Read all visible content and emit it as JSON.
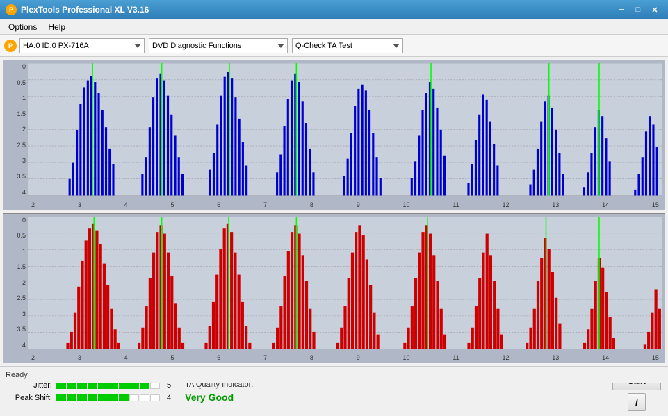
{
  "app": {
    "title": "PlexTools Professional XL V3.16",
    "icon": "P"
  },
  "window_controls": {
    "minimize": "─",
    "maximize": "□",
    "close": "✕"
  },
  "menu": {
    "items": [
      "Options",
      "Help"
    ]
  },
  "toolbar": {
    "device_icon": "P",
    "device_label": "HA:0 ID:0  PX-716A",
    "function_label": "DVD Diagnostic Functions",
    "test_label": "Q-Check TA Test"
  },
  "chart_top": {
    "title": "top_chart",
    "color": "blue",
    "y_labels": [
      "4",
      "3.5",
      "3",
      "2.5",
      "2",
      "1.5",
      "1",
      "0.5",
      "0"
    ],
    "x_labels": [
      "2",
      "3",
      "4",
      "5",
      "6",
      "7",
      "8",
      "9",
      "10",
      "11",
      "12",
      "13",
      "14",
      "15"
    ]
  },
  "chart_bottom": {
    "title": "bottom_chart",
    "color": "red",
    "y_labels": [
      "4",
      "3.5",
      "3",
      "2.5",
      "2",
      "1.5",
      "1",
      "0.5",
      "0"
    ],
    "x_labels": [
      "2",
      "3",
      "4",
      "5",
      "6",
      "7",
      "8",
      "9",
      "10",
      "11",
      "12",
      "13",
      "14",
      "15"
    ]
  },
  "metrics": {
    "jitter_label": "Jitter:",
    "jitter_value": "5",
    "jitter_segments_green": 9,
    "jitter_segments_total": 10,
    "peak_shift_label": "Peak Shift:",
    "peak_shift_value": "4",
    "peak_shift_segments_green": 7,
    "peak_shift_segments_total": 10,
    "ta_quality_label": "TA Quality Indicator:",
    "ta_quality_value": "Very Good"
  },
  "buttons": {
    "start": "Start",
    "info": "i"
  },
  "status": {
    "text": "Ready"
  }
}
